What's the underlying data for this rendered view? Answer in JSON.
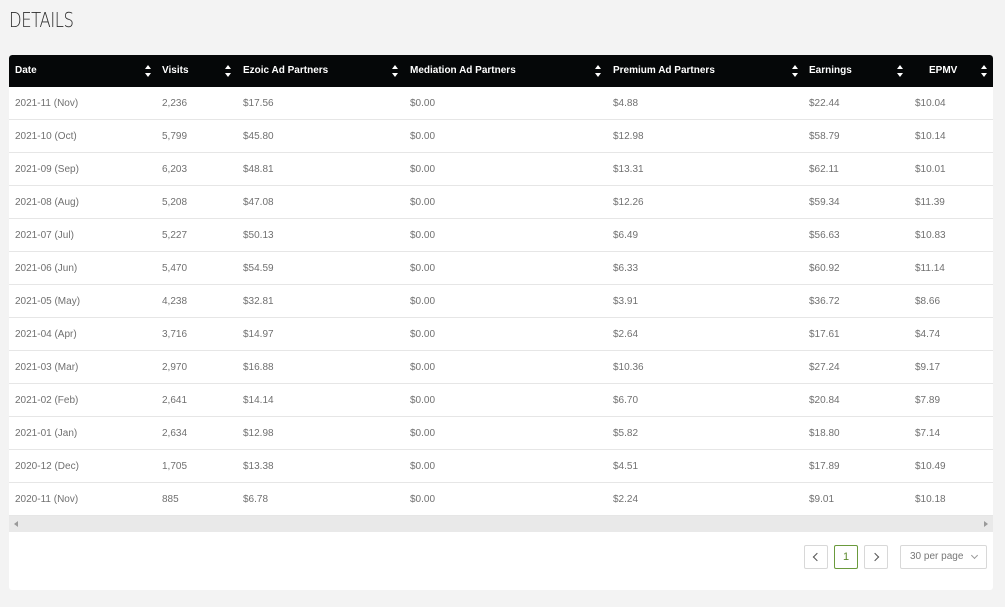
{
  "page": {
    "title": "DETAILS"
  },
  "table": {
    "columns": [
      {
        "key": "date",
        "label": "Date"
      },
      {
        "key": "visits",
        "label": "Visits"
      },
      {
        "key": "ezoic",
        "label": "Ezoic Ad Partners"
      },
      {
        "key": "mediation",
        "label": "Mediation Ad Partners"
      },
      {
        "key": "premium",
        "label": "Premium Ad Partners"
      },
      {
        "key": "earnings",
        "label": "Earnings"
      },
      {
        "key": "epmv",
        "label": "EPMV"
      }
    ],
    "rows": [
      [
        "2021-11 (Nov)",
        "2,236",
        "$17.56",
        "$0.00",
        "$4.88",
        "$22.44",
        "$10.04"
      ],
      [
        "2021-10 (Oct)",
        "5,799",
        "$45.80",
        "$0.00",
        "$12.98",
        "$58.79",
        "$10.14"
      ],
      [
        "2021-09 (Sep)",
        "6,203",
        "$48.81",
        "$0.00",
        "$13.31",
        "$62.11",
        "$10.01"
      ],
      [
        "2021-08 (Aug)",
        "5,208",
        "$47.08",
        "$0.00",
        "$12.26",
        "$59.34",
        "$11.39"
      ],
      [
        "2021-07 (Jul)",
        "5,227",
        "$50.13",
        "$0.00",
        "$6.49",
        "$56.63",
        "$10.83"
      ],
      [
        "2021-06 (Jun)",
        "5,470",
        "$54.59",
        "$0.00",
        "$6.33",
        "$60.92",
        "$11.14"
      ],
      [
        "2021-05 (May)",
        "4,238",
        "$32.81",
        "$0.00",
        "$3.91",
        "$36.72",
        "$8.66"
      ],
      [
        "2021-04 (Apr)",
        "3,716",
        "$14.97",
        "$0.00",
        "$2.64",
        "$17.61",
        "$4.74"
      ],
      [
        "2021-03 (Mar)",
        "2,970",
        "$16.88",
        "$0.00",
        "$10.36",
        "$27.24",
        "$9.17"
      ],
      [
        "2021-02 (Feb)",
        "2,641",
        "$14.14",
        "$0.00",
        "$6.70",
        "$20.84",
        "$7.89"
      ],
      [
        "2021-01 (Jan)",
        "2,634",
        "$12.98",
        "$0.00",
        "$5.82",
        "$18.80",
        "$7.14"
      ],
      [
        "2020-12 (Dec)",
        "1,705",
        "$13.38",
        "$0.00",
        "$4.51",
        "$17.89",
        "$10.49"
      ],
      [
        "2020-11 (Nov)",
        "885",
        "$6.78",
        "$0.00",
        "$2.24",
        "$9.01",
        "$10.18"
      ]
    ]
  },
  "pagination": {
    "current_page": "1",
    "per_page": "30 per page",
    "prev_icon": "chevron-left-icon",
    "next_icon": "chevron-right-icon"
  },
  "colors": {
    "header_bg": "#050708",
    "page_bg": "#f3f3f3",
    "active_page": "#6a9a3c"
  }
}
